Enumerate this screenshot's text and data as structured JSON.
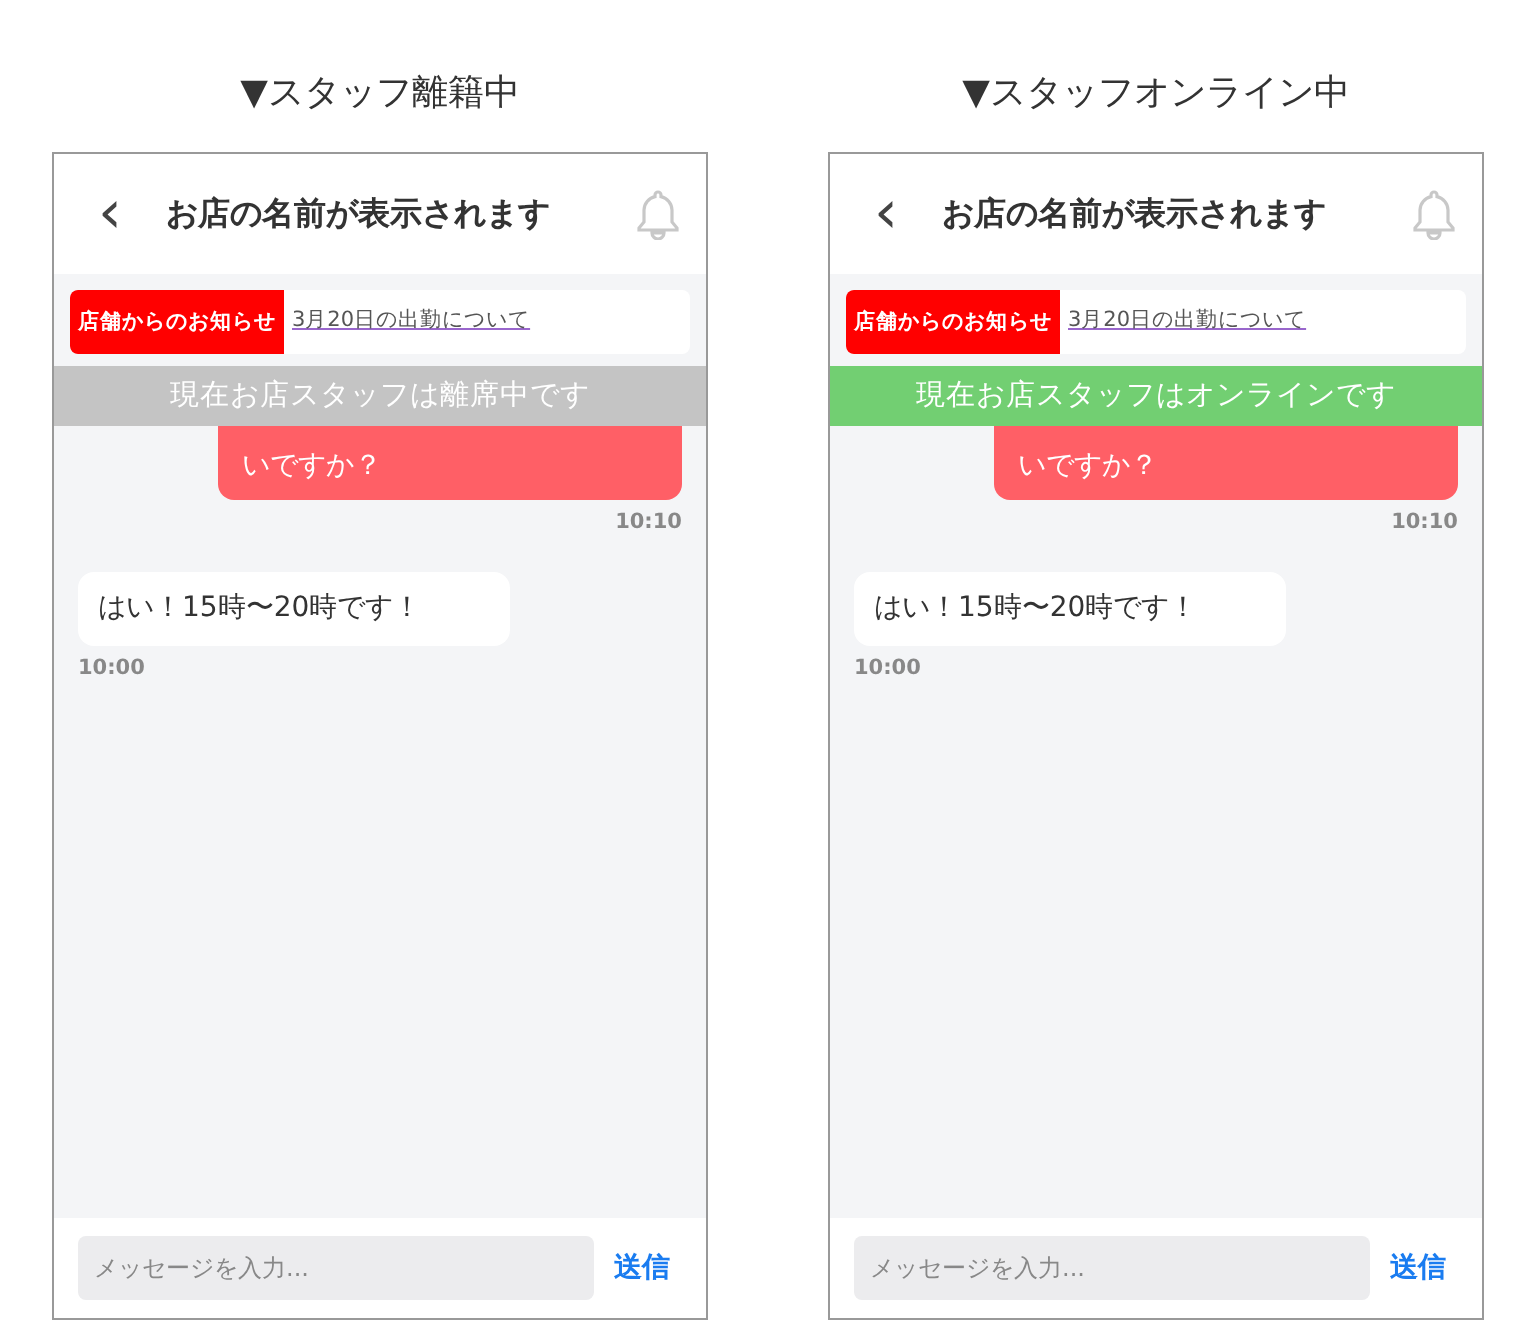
{
  "screens": [
    {
      "caption": "▼スタッフ離籍中",
      "header": {
        "back": "‹",
        "title": "お店の名前が表示されます"
      },
      "notice": {
        "tag": "店舗からのお知らせ",
        "link": "3月20日の出勤について"
      },
      "status": {
        "kind": "away",
        "text": "現在お店スタッフは離席中です"
      },
      "messages": [
        {
          "kind": "sent",
          "text": "いですか？",
          "time": "10:10"
        },
        {
          "kind": "received",
          "text": "はい！15時〜20時です！",
          "time": "10:00"
        }
      ],
      "composer": {
        "placeholder": "メッセージを入力...",
        "send": "送信"
      }
    },
    {
      "caption": "▼スタッフオンライン中",
      "header": {
        "back": "‹",
        "title": "お店の名前が表示されます"
      },
      "notice": {
        "tag": "店舗からのお知らせ",
        "link": "3月20日の出勤について"
      },
      "status": {
        "kind": "online",
        "text": "現在お店スタッフはオンラインです"
      },
      "messages": [
        {
          "kind": "sent",
          "text": "いですか？",
          "time": "10:10"
        },
        {
          "kind": "received",
          "text": "はい！15時〜20時です！",
          "time": "10:00"
        }
      ],
      "composer": {
        "placeholder": "メッセージを入力...",
        "send": "送信"
      }
    }
  ]
}
